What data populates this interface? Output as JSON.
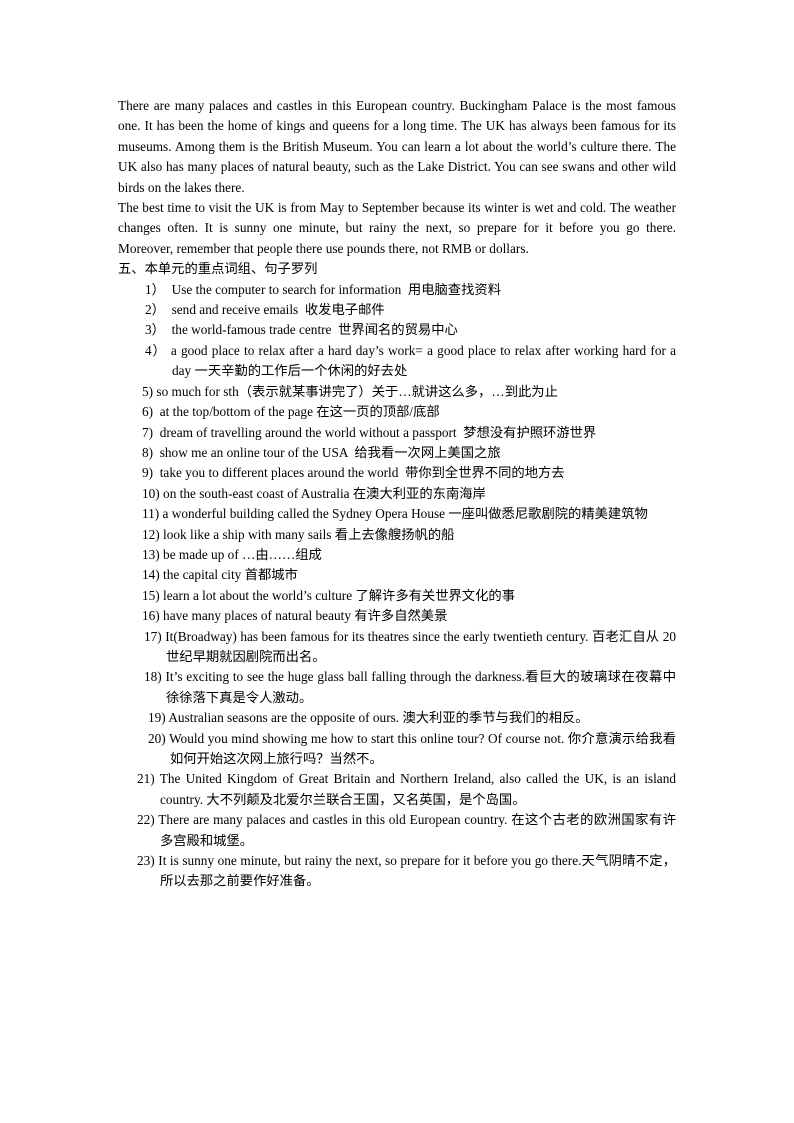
{
  "document": {
    "paragraphs": [
      "There are many palaces and castles in this European country. Buckingham Palace is the most famous one. It has been the home of kings and queens for a long time. The UK has always been famous for its museums. Among them is the British Museum. You can learn a lot about the world’s culture there. The UK also has many places of natural beauty, such as the Lake District. You can see swans and other wild birds on the lakes there.",
      "The best time to visit the UK is from May to September because its winter is wet and cold. The weather changes often. It is sunny one minute, but rainy the next, so prepare for it before you go there. Moreover, remember that people there use pounds there, not RMB or dollars."
    ],
    "section_heading": "五、本单元的重点词组、句子罗列",
    "items": [
      {
        "num": "1）",
        "text": "  Use the computer to search for information  用电脑查找资料"
      },
      {
        "num": "2）",
        "text": "  send and receive emails  收发电子邮件"
      },
      {
        "num": "3）",
        "text": "  the world-famous trade centre  世界闻名的贸易中心"
      },
      {
        "num": "4）",
        "text": " a good place to relax after a hard day’s work= a good place to relax after working   hard for a day  一天辛勤的工作后一个休闲的好去处"
      },
      {
        "num": "5)",
        "text": " so much for sth（表示就某事讲完了）关于…就讲这么多，…到此为止"
      },
      {
        "num": "6)",
        "text": "  at the top/bottom of the page 在这一页的顶部/底部"
      },
      {
        "num": "7)",
        "text": "  dream of travelling around the world without a passport  梦想没有护照环游世界"
      },
      {
        "num": "8)",
        "text": "  show me an online tour of the USA  给我看一次网上美国之旅"
      },
      {
        "num": "9)",
        "text": "  take you to different places around the world  带你到全世界不同的地方去"
      },
      {
        "num": "10)",
        "text": " on the south-east coast of Australia  在澳大利亚的东南海岸"
      },
      {
        "num": "11)",
        "text": " a wonderful building called the Sydney Opera House  一座叫做悉尼歌剧院的精美建筑物"
      },
      {
        "num": "12)",
        "text": " look like a ship with many sails  看上去像艘扬帆的船"
      },
      {
        "num": "13)",
        "text": " be made up of …由……组成"
      },
      {
        "num": "14)",
        "text": " the capital city 首都城市"
      },
      {
        "num": "15)",
        "text": " learn a lot about the world’s culture  了解许多有关世界文化的事"
      },
      {
        "num": "16)",
        "text": " have many places of natural beauty  有许多自然美景"
      },
      {
        "num": "17)",
        "text": " It(Broadway) has been famous for its theatres since the early twentieth century.  百老汇自从 20 世纪早期就因剧院而出名。"
      },
      {
        "num": "18)",
        "text": " It’s exciting to see the huge glass ball falling through the darkness.看巨大的玻璃球在夜幕中徐徐落下真是令人激动。"
      },
      {
        "num": "19)",
        "text": " Australian seasons are the opposite of ours.  澳大利亚的季节与我们的相反。"
      },
      {
        "num": "20)",
        "text": " Would you mind showing me how to start this online tour? Of course not.  你介意演示给我看如何开始这次网上旅行吗？当然不。"
      },
      {
        "num": "21)",
        "text": " The United Kingdom of Great Britain and Northern Ireland, also called the UK, is an island country.  大不列颠及北爱尔兰联合王国，又名英国，是个岛国。"
      },
      {
        "num": "22)",
        "text": " There are many palaces and castles in this old European country.  在这个古老的欧洲国家有许多宫殿和城堡。"
      },
      {
        "num": "23)",
        "text": " It is sunny one minute, but rainy the next, so prepare for it before you go there.天气阴晴不定，所以去那之前要作好准备。"
      }
    ]
  }
}
